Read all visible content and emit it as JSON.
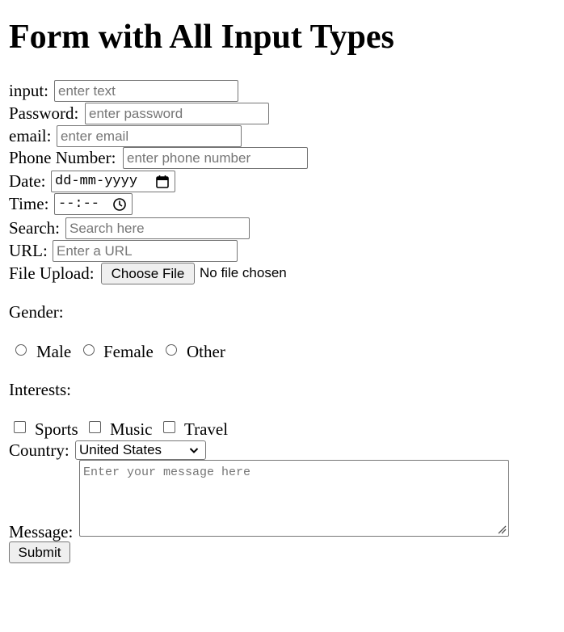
{
  "page": {
    "title": "Form with All Input Types"
  },
  "fields": {
    "input": {
      "label": "input:",
      "placeholder": "enter text"
    },
    "password": {
      "label": "Password:",
      "placeholder": "enter password"
    },
    "email": {
      "label": "email:",
      "placeholder": "enter email"
    },
    "phone": {
      "label": "Phone Number:",
      "placeholder": "enter phone number"
    },
    "date": {
      "label": "Date:",
      "value": "dd-mm-yyyy",
      "icon": "calendar-icon"
    },
    "time": {
      "label": "Time:",
      "value": "--:--",
      "icon": "clock-icon"
    },
    "search": {
      "label": "Search:",
      "placeholder": "Search here"
    },
    "url": {
      "label": "URL:",
      "placeholder": "Enter a URL"
    },
    "file": {
      "label": "File Upload:",
      "button": "Choose File",
      "status": "No file chosen"
    }
  },
  "gender": {
    "label": "Gender:",
    "options": [
      "Male",
      "Female",
      "Other"
    ]
  },
  "interests": {
    "label": "Interests:",
    "options": [
      "Sports",
      "Music",
      "Travel"
    ]
  },
  "country": {
    "label": "Country:",
    "selected": "United States",
    "icon": "chevron-down-icon"
  },
  "message": {
    "label": "Message:",
    "placeholder": "Enter your message here"
  },
  "submit": {
    "label": "Submit"
  }
}
